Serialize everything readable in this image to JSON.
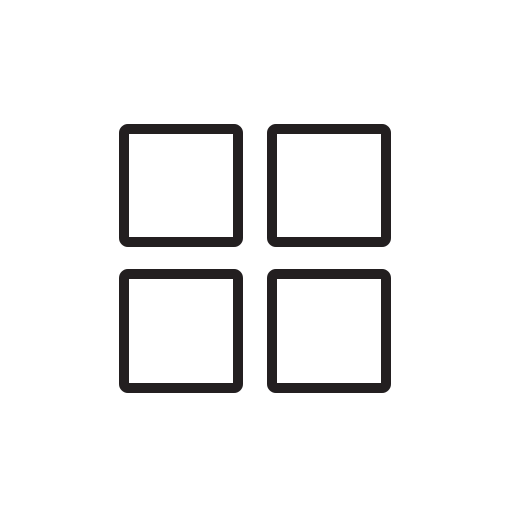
{
  "icon": {
    "name": "grid-icon",
    "description_name": "four-squares-grid",
    "stroke_color": "#231f20",
    "background_color": "#ffffff",
    "cells": [
      {
        "name": "grid-cell-top-left"
      },
      {
        "name": "grid-cell-top-right"
      },
      {
        "name": "grid-cell-bottom-left"
      },
      {
        "name": "grid-cell-bottom-right"
      }
    ]
  }
}
